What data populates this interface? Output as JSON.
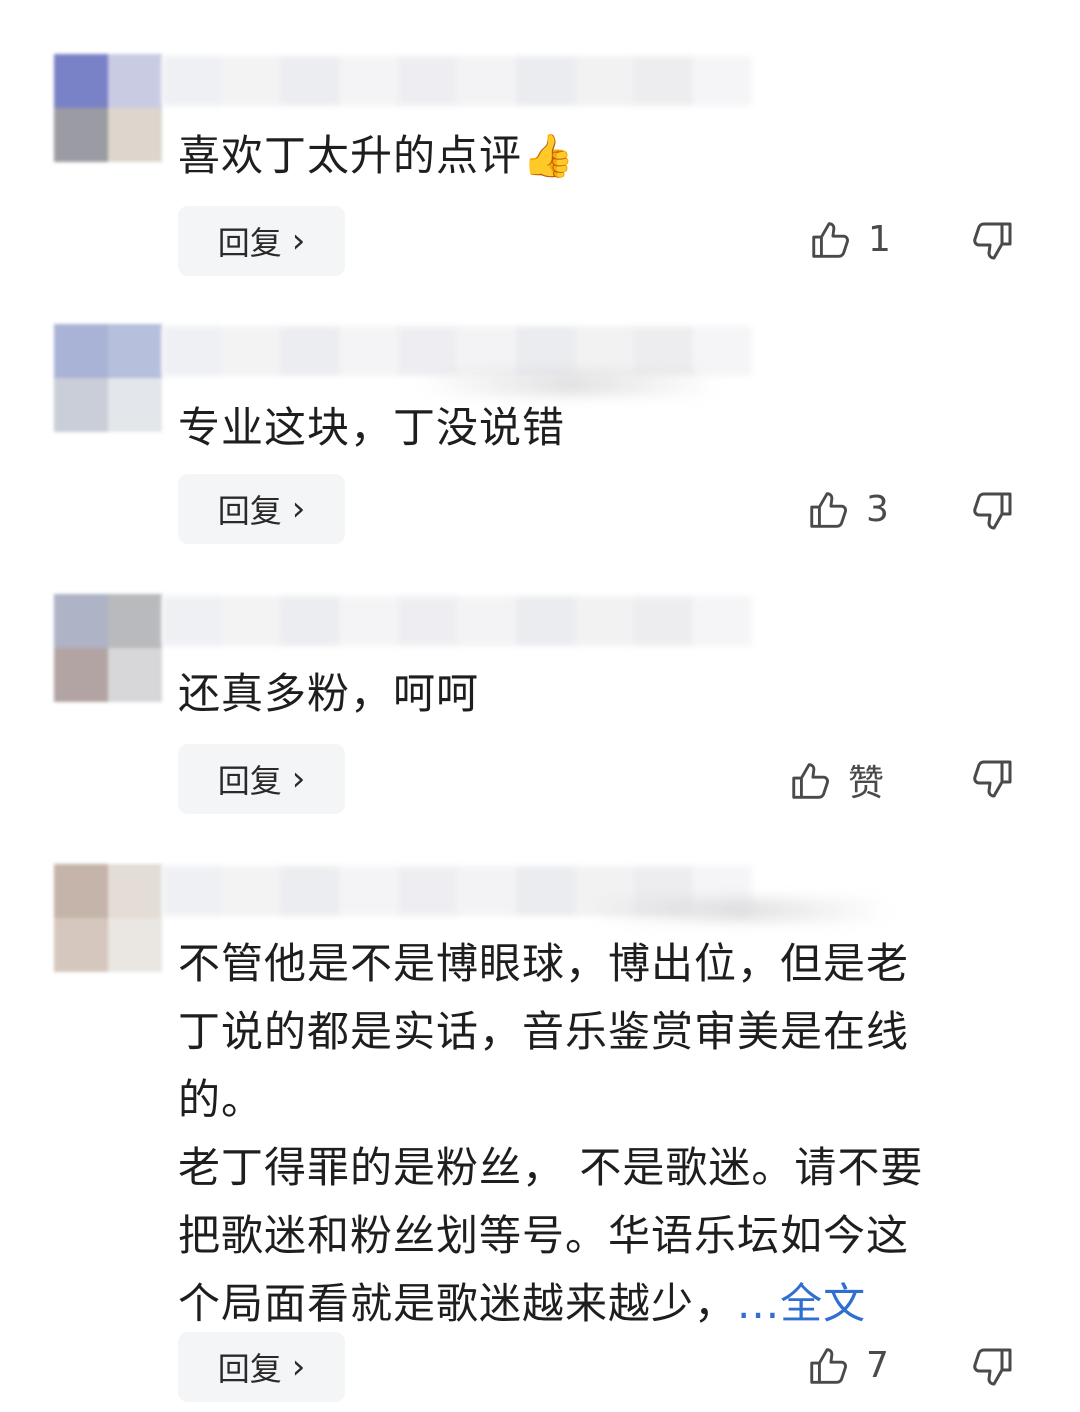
{
  "reply_label": "回复",
  "comments": [
    {
      "text": "喜欢丁太升的点评👍",
      "likes": "1",
      "avatar_colors": [
        "#7a82c7",
        "#c9cbe3",
        "#9b9ba3",
        "#dcd6cc"
      ]
    },
    {
      "text": "专业这块，丁没说错",
      "likes": "3",
      "avatar_colors": [
        "#a9b3d6",
        "#b6bfdc",
        "#c9ced8",
        "#e3e6ea"
      ]
    },
    {
      "text": "还真多粉，呵呵",
      "likes": "赞",
      "avatar_colors": [
        "#aeb3c5",
        "#b9babd",
        "#b3a4a4",
        "#d7d6d8"
      ]
    },
    {
      "text": "不管他是不是博眼球，博出位，但是老\n丁说的都是实话，音乐鉴赏审美是在线\n的。\n老丁得罪的是粉丝， 不是歌迷。请不要\n把歌迷和粉丝划等号。华语乐坛如今这\n个局面看就是歌迷越来越少，",
      "more_label": "...全文",
      "likes": "7",
      "avatar_colors": [
        "#c4b4a9",
        "#e4ddd6",
        "#d5c7bd",
        "#eae6e1"
      ]
    }
  ]
}
